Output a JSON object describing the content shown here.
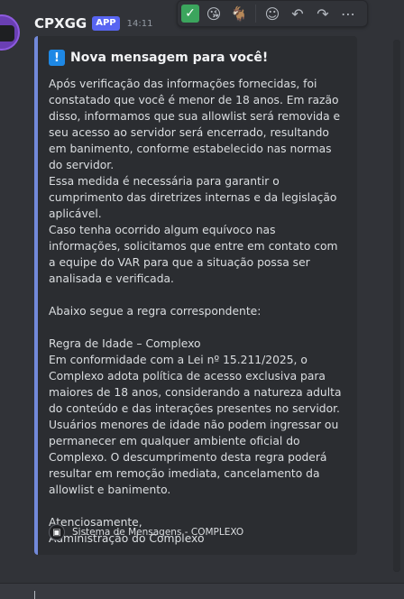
{
  "message": {
    "username": "CPXGG",
    "badge": "APP",
    "timestamp": "14:11"
  },
  "toolbar": {
    "icons": [
      "check-reaction",
      "kiss-emoji-reaction",
      "goat-reaction",
      "add-reaction",
      "reply",
      "forward",
      "more-options"
    ],
    "check": "✓",
    "kiss": "😘",
    "goat": "🐐",
    "add_reaction": "☺",
    "reply": "↶",
    "forward": "↷",
    "more": "⋯"
  },
  "embed": {
    "accent_color": "#7289da",
    "title_icon": "!",
    "title": "Nova mensagem para você!",
    "body": "Após verificação das informações fornecidas, foi constatado que você é menor de 18 anos. Em razão disso, informamos que sua allowlist será removida e seu acesso ao servidor será encerrado, resultando em banimento, conforme estabelecido nas normas do servidor.\nEssa medida é necessária para garantir o cumprimento das diretrizes internas e da legislação aplicável.\nCaso tenha ocorrido algum equívoco nas informações, solicitamos que entre em contato com a equipe do VAR para que a situação possa ser analisada e verificada.\n\nAbaixo segue a regra correspondente:\n\nRegra de Idade – Complexo\nEm conformidade com a Lei nº 15.211/2025, o Complexo adota política de acesso exclusiva para maiores de 18 anos, considerando a natureza adulta do conteúdo e das interações presentes no servidor. Usuários menores de idade não podem ingressar ou permanecer em qualquer ambiente oficial do Complexo. O descumprimento desta regra poderá resultar em remoção imediata, cancelamento da allowlist e banimento.\n\nAtenciosamente,\nAdministração do Complexo",
    "footer_text": "Sistema de Mensagens - COMPLEXO"
  }
}
